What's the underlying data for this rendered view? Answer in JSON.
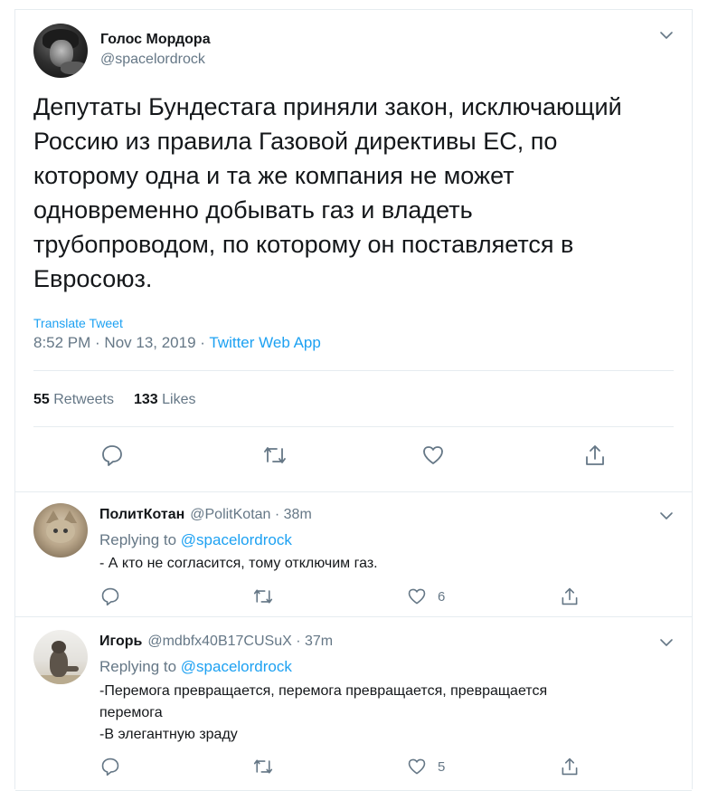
{
  "tweet": {
    "author_name": "Голос Мордора",
    "author_handle": "@spacelordrock",
    "text": "Депутаты Бундестага приняли закон, исключающий\nРоссию из правила Газовой директивы ЕС, по\nкоторому одна и та же компания не может\nодновременно добывать газ и владеть\nтрубопроводом, по которому он поставляется в\nЕвросоюз.",
    "translate_label": "Translate Tweet",
    "time": "8:52 PM · Nov 13, 2019 · ",
    "app": "Twitter Web App",
    "retweets_count": "55",
    "retweets_label": "Retweets",
    "likes_count": "133",
    "likes_label": "Likes"
  },
  "replies": [
    {
      "name": "ПолитКотан",
      "meta": "@PolitKotan · 38m",
      "replying_prefix": "Replying to ",
      "replying_to": "@spacelordrock",
      "text": "- А кто не согласится, тому отключим газ.",
      "like_count": "6"
    },
    {
      "name": "Игорь",
      "meta": "@mdbfx40B17CUSuX · 37m",
      "replying_prefix": "Replying to ",
      "replying_to": "@spacelordrock",
      "text": "-Перемога превращается, перемога превращается, превращается\nперемога\n-В элегантную зраду",
      "like_count": "5"
    }
  ],
  "icons": [
    "chevron-down-icon",
    "reply-icon",
    "retweet-icon",
    "like-icon",
    "share-icon"
  ],
  "colors": {
    "accent": "#1da1f2",
    "secondary": "#657786",
    "text": "#14171a",
    "border": "#e6ecf0"
  }
}
